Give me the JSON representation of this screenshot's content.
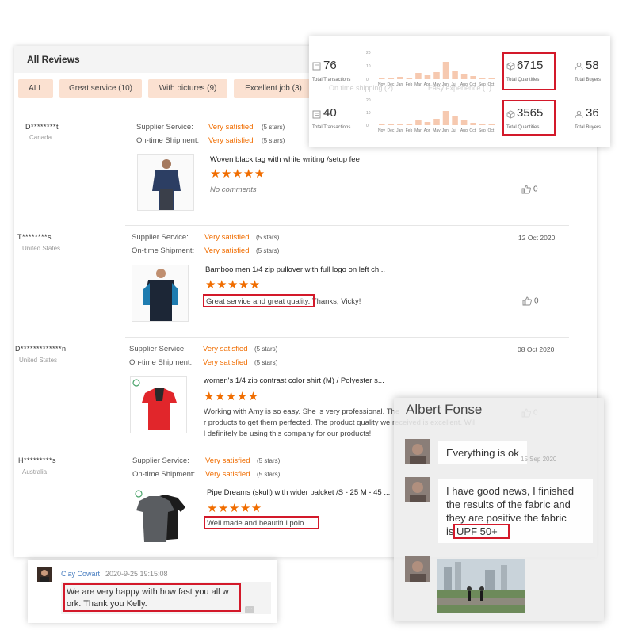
{
  "panel": {
    "title": "All Reviews"
  },
  "filters": [
    {
      "label": "ALL"
    },
    {
      "label": "Great service (10)"
    },
    {
      "label": "With pictures (9)"
    },
    {
      "label": "Excellent job (3)"
    }
  ],
  "ratings": {
    "supplier_label": "Supplier Service:",
    "shipment_label": "On-time Shipment:",
    "value": "Very satisfied",
    "stars_text": "(5 stars)"
  },
  "reviews": [
    {
      "name": "D********t",
      "country": "Canada",
      "date": "",
      "product_title": "Woven black tag with white writing /setup fee",
      "stars": "★★★★★",
      "comment": "No comments",
      "comment_highlight": "",
      "comment_rest": "",
      "likes": "0"
    },
    {
      "name": "T********s",
      "country": "United States",
      "date": "12 Oct 2020",
      "product_title": "Bamboo men 1/4 zip pullover with full logo on left ch...",
      "stars": "★★★★★",
      "comment": "",
      "comment_highlight": "Great service and great quality",
      "comment_rest": ". Thanks, Vicky!",
      "likes": "0"
    },
    {
      "name": "D*************n",
      "country": "United States",
      "date": "08 Oct 2020",
      "product_title": "women's 1/4 zip contrast color shirt (M) / Polyester s...",
      "stars": "★★★★★",
      "comment_lines": [
        "Working with Amy is so easy. She is very professional. The",
        "r products to get them perfected. The product quality we received is excellent. Wil",
        "l definitely be using this company for our products!!"
      ],
      "likes": "0"
    },
    {
      "name": "H*********s",
      "country": "Australia",
      "date": "",
      "product_title": "Pipe Dreams (skull) with wider palcket /S - 25 M - 45 ...",
      "stars": "★★★★★",
      "comment": "",
      "comment_highlight": "Well made and beautiful polo",
      "comment_rest": "",
      "likes": "0"
    }
  ],
  "stats": {
    "row1": {
      "transactions": "76",
      "quantities": "6715",
      "buyers": "58"
    },
    "row2": {
      "transactions": "40",
      "quantities": "3565",
      "buyers": "36"
    },
    "transactions_label": "Total Transactions",
    "quantities_label": "Total Quantities",
    "buyers_label": "Total Buyers",
    "months": "Nov Dec Jan Feb Mar Apr May Jun Jul Aug Oct Sep Oct",
    "ghost_1": "On time shipping (2)",
    "ghost_2": "Easy experience (1)",
    "chart_ticks": [
      "20",
      "10",
      "0"
    ]
  },
  "chat_left": {
    "author": "Clay Cowart",
    "datetime": "2020-9-25 19:15:08",
    "line1": "We are very happy with how fast you all w",
    "line2": "ork. Thank you Kelly."
  },
  "chat_right": {
    "title": "Albert Fonse",
    "msg1": "Everything is ok",
    "msg1_date": "15 Sep 2020",
    "msg2_line1": "I have good news, I finished",
    "msg2_line2": "the results of the fabric and",
    "msg2_line3": "they are positive the fabric",
    "msg2_line4_prefix": "is",
    "msg2_highlight": "UPF 50+"
  },
  "colors": {
    "accent_orange": "#f06d00",
    "chip_bg": "#fbe1d1",
    "highlight_red": "#d3192a",
    "chart_bar": "#f6c9b0",
    "link_blue": "#4a7fc1"
  }
}
